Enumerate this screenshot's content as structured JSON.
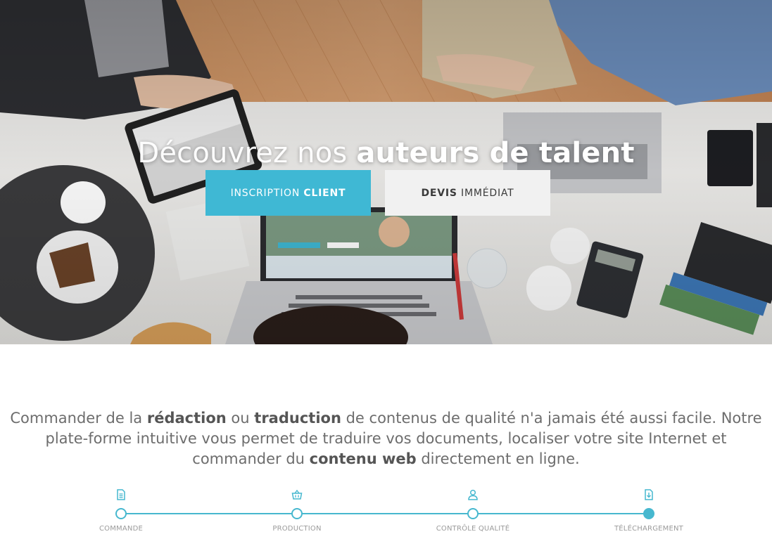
{
  "hero": {
    "title_light": "Découvrez nos",
    "title_strong": "auteurs de talent",
    "buttons": {
      "client": {
        "prefix": "INSCRIPTION",
        "bold": "CLIENT"
      },
      "devis": {
        "bold": "DEVIS",
        "suffix": "IMMÉDIAT"
      }
    }
  },
  "intro": {
    "part1": "Commander de la",
    "bold1": "rédaction",
    "part2": "ou",
    "bold2": "traduction",
    "part3": "de contenus de qualité n'a jamais été aussi facile. Notre plate-forme intuitive vous permet de traduire vos documents, localiser votre site Internet et commander du",
    "bold3": "contenu web",
    "part4": "directement en ligne."
  },
  "steps": [
    {
      "label": "COMMANDE",
      "icon": "document-icon",
      "active": false
    },
    {
      "label": "PRODUCTION",
      "icon": "basket-icon",
      "active": false
    },
    {
      "label": "CONTRÔLE QUALITÉ",
      "icon": "user-icon",
      "active": false
    },
    {
      "label": "TÉLÉCHARGEMENT",
      "icon": "download-file-icon",
      "active": true
    }
  ],
  "colors": {
    "accent": "#3fb8d4",
    "step_line": "#47b8cf",
    "text": "#6d6d6d"
  }
}
